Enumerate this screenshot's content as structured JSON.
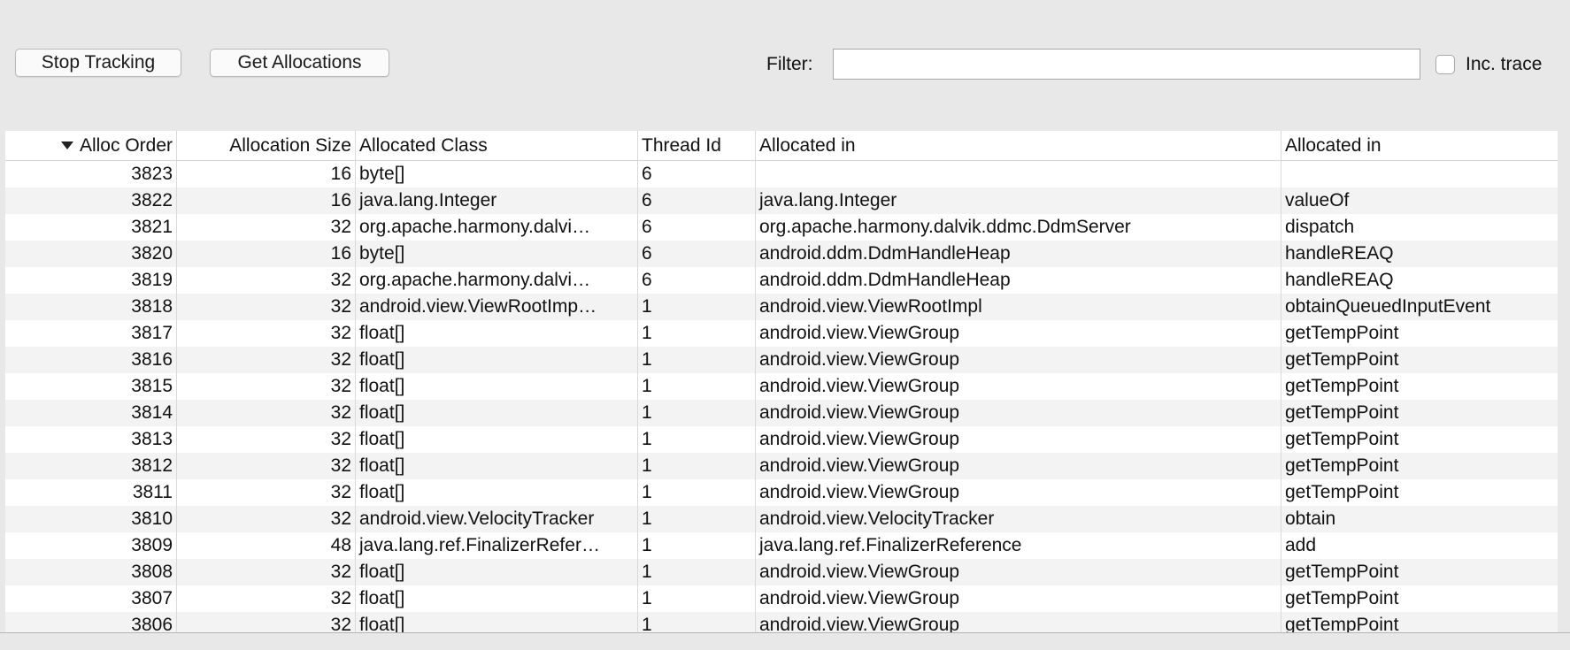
{
  "toolbar": {
    "stop_tracking": "Stop Tracking",
    "get_allocations": "Get Allocations",
    "filter_label": "Filter:",
    "filter_value": "",
    "inc_trace_label": "Inc. trace",
    "inc_trace_checked": false
  },
  "table": {
    "columns": [
      "Alloc Order",
      "Allocation Size",
      "Allocated Class",
      "Thread Id",
      "Allocated in",
      "Allocated in"
    ],
    "sort_column": "Alloc Order",
    "sort_direction": "descending",
    "rows": [
      [
        "3823",
        "16",
        "byte[]",
        "6",
        "",
        ""
      ],
      [
        "3822",
        "16",
        "java.lang.Integer",
        "6",
        "java.lang.Integer",
        "valueOf"
      ],
      [
        "3821",
        "32",
        "org.apache.harmony.dalvi…",
        "6",
        "org.apache.harmony.dalvik.ddmc.DdmServer",
        "dispatch"
      ],
      [
        "3820",
        "16",
        "byte[]",
        "6",
        "android.ddm.DdmHandleHeap",
        "handleREAQ"
      ],
      [
        "3819",
        "32",
        "org.apache.harmony.dalvi…",
        "6",
        "android.ddm.DdmHandleHeap",
        "handleREAQ"
      ],
      [
        "3818",
        "32",
        "android.view.ViewRootImp…",
        "1",
        "android.view.ViewRootImpl",
        "obtainQueuedInputEvent"
      ],
      [
        "3817",
        "32",
        "float[]",
        "1",
        "android.view.ViewGroup",
        "getTempPoint"
      ],
      [
        "3816",
        "32",
        "float[]",
        "1",
        "android.view.ViewGroup",
        "getTempPoint"
      ],
      [
        "3815",
        "32",
        "float[]",
        "1",
        "android.view.ViewGroup",
        "getTempPoint"
      ],
      [
        "3814",
        "32",
        "float[]",
        "1",
        "android.view.ViewGroup",
        "getTempPoint"
      ],
      [
        "3813",
        "32",
        "float[]",
        "1",
        "android.view.ViewGroup",
        "getTempPoint"
      ],
      [
        "3812",
        "32",
        "float[]",
        "1",
        "android.view.ViewGroup",
        "getTempPoint"
      ],
      [
        "3811",
        "32",
        "float[]",
        "1",
        "android.view.ViewGroup",
        "getTempPoint"
      ],
      [
        "3810",
        "32",
        "android.view.VelocityTracker",
        "1",
        "android.view.VelocityTracker",
        "obtain"
      ],
      [
        "3809",
        "48",
        "java.lang.ref.FinalizerRefer…",
        "1",
        "java.lang.ref.FinalizerReference",
        "add"
      ],
      [
        "3808",
        "32",
        "float[]",
        "1",
        "android.view.ViewGroup",
        "getTempPoint"
      ],
      [
        "3807",
        "32",
        "float[]",
        "1",
        "android.view.ViewGroup",
        "getTempPoint"
      ],
      [
        "3806",
        "32",
        "float[]",
        "1",
        "android.view.ViewGroup",
        "getTempPoint"
      ]
    ]
  },
  "colors": {
    "window_bg": "#e8e8e8",
    "row_alt": "#f3f3f3",
    "grid_line": "#d9d9d9"
  },
  "icons": {
    "sort": "sort-descending-icon"
  }
}
